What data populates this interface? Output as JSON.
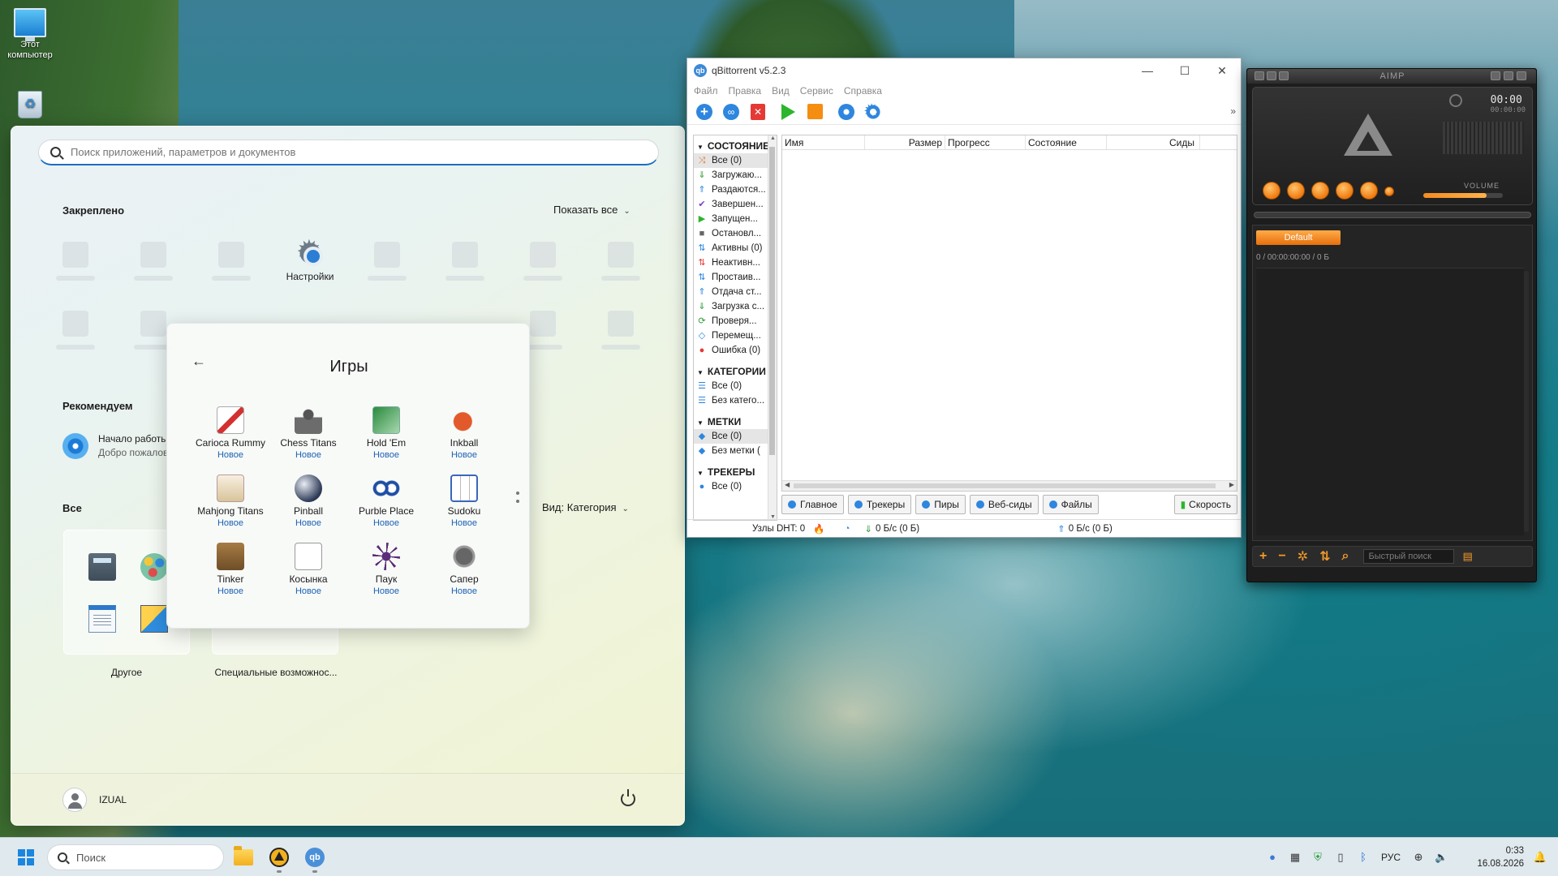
{
  "desktop": {
    "icons": [
      {
        "label": "Этот компьютер"
      },
      {
        "label": ""
      }
    ]
  },
  "start_menu": {
    "search_placeholder": "Поиск приложений, параметров и документов",
    "pinned_title": "Закреплено",
    "show_all_label": "Показать все",
    "pinned_app_settings": "Настройки",
    "recommended_title": "Рекомендуем",
    "recommended_item": {
      "title": "Начало работы",
      "subtitle": "Добро пожалов"
    },
    "all_title": "Все",
    "view_by_label": "Вид: Категория",
    "folders": [
      {
        "label": "Другое"
      },
      {
        "label": "Специальные возможнос..."
      }
    ],
    "user_name": "IZUAL"
  },
  "games_folder": {
    "title": "Игры",
    "items": [
      {
        "name": "Carioca Rummy",
        "badge": "Новое",
        "icon": "carioca-rummy-icon"
      },
      {
        "name": "Chess Titans",
        "badge": "Новое",
        "icon": "chess-titans-icon"
      },
      {
        "name": "Hold 'Em",
        "badge": "Новое",
        "icon": "hold-em-icon"
      },
      {
        "name": "Inkball",
        "badge": "Новое",
        "icon": "inkball-icon"
      },
      {
        "name": "Mahjong Titans",
        "badge": "Новое",
        "icon": "mahjong-titans-icon"
      },
      {
        "name": "Pinball",
        "badge": "Новое",
        "icon": "pinball-icon"
      },
      {
        "name": "Purble Place",
        "badge": "Новое",
        "icon": "purble-place-icon"
      },
      {
        "name": "Sudoku",
        "badge": "Новое",
        "icon": "sudoku-icon"
      },
      {
        "name": "Tinker",
        "badge": "Новое",
        "icon": "tinker-icon"
      },
      {
        "name": "Косынка",
        "badge": "Новое",
        "icon": "solitaire-icon"
      },
      {
        "name": "Паук",
        "badge": "Новое",
        "icon": "spider-icon"
      },
      {
        "name": "Сапер",
        "badge": "Новое",
        "icon": "minesweeper-icon"
      }
    ]
  },
  "qbittorrent": {
    "title": "qBittorrent v5.2.3",
    "menu": [
      "Файл",
      "Правка",
      "Вид",
      "Сервис",
      "Справка"
    ],
    "sidebar": {
      "status_header": "СОСТОЯНИЕ",
      "status_items": [
        {
          "label": "Все (0)",
          "icon": "filter-all-icon",
          "color": "#e0782e"
        },
        {
          "label": "Загружаю...",
          "icon": "download-icon",
          "color": "#2e9d3a"
        },
        {
          "label": "Раздаются...",
          "icon": "upload-icon",
          "color": "#2e86de"
        },
        {
          "label": "Завершен...",
          "icon": "check-icon",
          "color": "#7d3cc8"
        },
        {
          "label": "Запущен...",
          "icon": "play-icon",
          "color": "#2db52d"
        },
        {
          "label": "Остановл...",
          "icon": "stop-icon",
          "color": "#666666"
        },
        {
          "label": "Активны (0)",
          "icon": "active-arrows-icon",
          "color": "#2e86de"
        },
        {
          "label": "Неактивн...",
          "icon": "inactive-arrows-icon",
          "color": "#e53935"
        },
        {
          "label": "Простаив...",
          "icon": "stalled-icon",
          "color": "#2e86de"
        },
        {
          "label": "Отдача ст...",
          "icon": "stalled-upload-icon",
          "color": "#2e86de"
        },
        {
          "label": "Загрузка с...",
          "icon": "stalled-download-icon",
          "color": "#2e9d3a"
        },
        {
          "label": "Проверя...",
          "icon": "checking-icon",
          "color": "#2e9d3a"
        },
        {
          "label": "Перемещ...",
          "icon": "moving-icon",
          "color": "#2e86de"
        },
        {
          "label": "Ошибка (0)",
          "icon": "error-icon",
          "color": "#e53935"
        }
      ],
      "categories_header": "КАТЕГОРИИ",
      "categories_items": [
        {
          "label": "Все (0)"
        },
        {
          "label": "Без катего..."
        }
      ],
      "tags_header": "МЕТКИ",
      "tags_items": [
        {
          "label": "Все (0)"
        },
        {
          "label": "Без метки ("
        }
      ],
      "trackers_header": "ТРЕКЕРЫ",
      "trackers_items": [
        {
          "label": "Все (0)"
        }
      ]
    },
    "columns": [
      "Имя",
      "Размер",
      "Прогресс",
      "Состояние",
      "Сиды"
    ],
    "tabs": [
      "Главное",
      "Трекеры",
      "Пиры",
      "Веб-сиды",
      "Файлы"
    ],
    "speed_tab": "Скорость",
    "status_bar": {
      "dht": "Узлы DHT: 0",
      "download": "0 Б/с (0 Б)",
      "upload": "0 Б/с (0 Б)"
    }
  },
  "aimp": {
    "title": "AIMP",
    "time": "00:00",
    "time_small": "00:00:00",
    "volume_label": "VOLUME",
    "volume_level": 0.8,
    "playlist_tab": "Default",
    "playlist_info": "0 / 00:00:00:00 / 0 Б",
    "quick_search_placeholder": "Быстрый поиск"
  },
  "taskbar": {
    "search_label": "Поиск",
    "language": "РУС",
    "time": "0:33",
    "date": "16.08.2026"
  }
}
